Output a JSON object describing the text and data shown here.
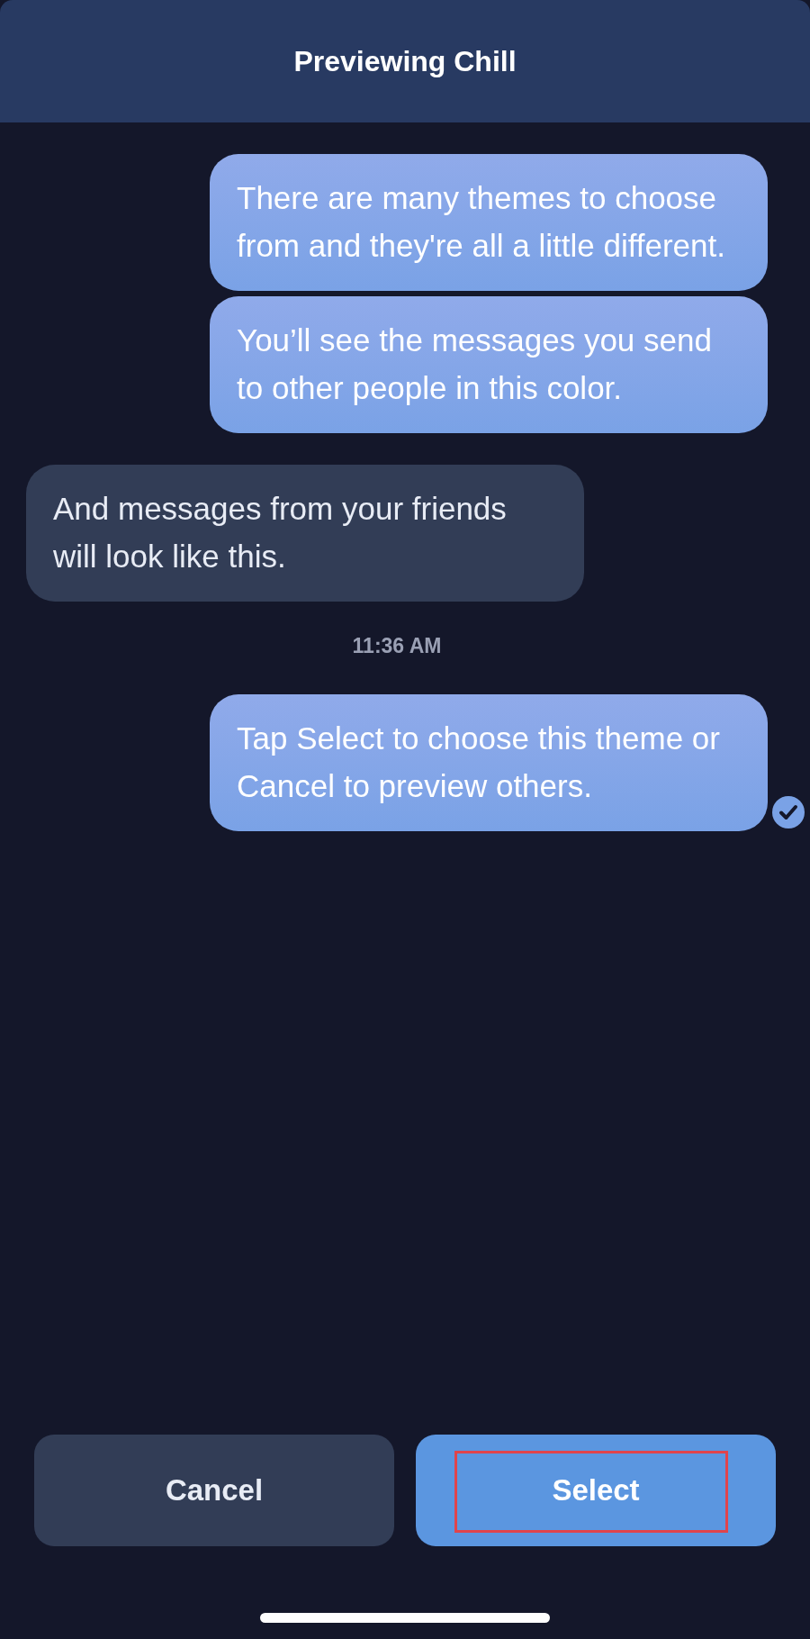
{
  "header": {
    "title": "Previewing Chill"
  },
  "messages": [
    {
      "kind": "sent",
      "text": "There are many themes to choose from and they're all a little different.",
      "read": false
    },
    {
      "kind": "sent",
      "text": "You’ll see the messages you send to other people in this color.",
      "read": false
    },
    {
      "kind": "received",
      "text": "And messages from your friends will look like this."
    },
    {
      "kind": "timestamp",
      "text": "11:36 AM"
    },
    {
      "kind": "sent",
      "text": "Tap Select to choose this theme or Cancel to preview others.",
      "read": true
    }
  ],
  "buttons": [
    {
      "kind": "cancel",
      "label": "Cancel",
      "highlighted": false
    },
    {
      "kind": "select",
      "label": "Select",
      "highlighted": true
    }
  ]
}
